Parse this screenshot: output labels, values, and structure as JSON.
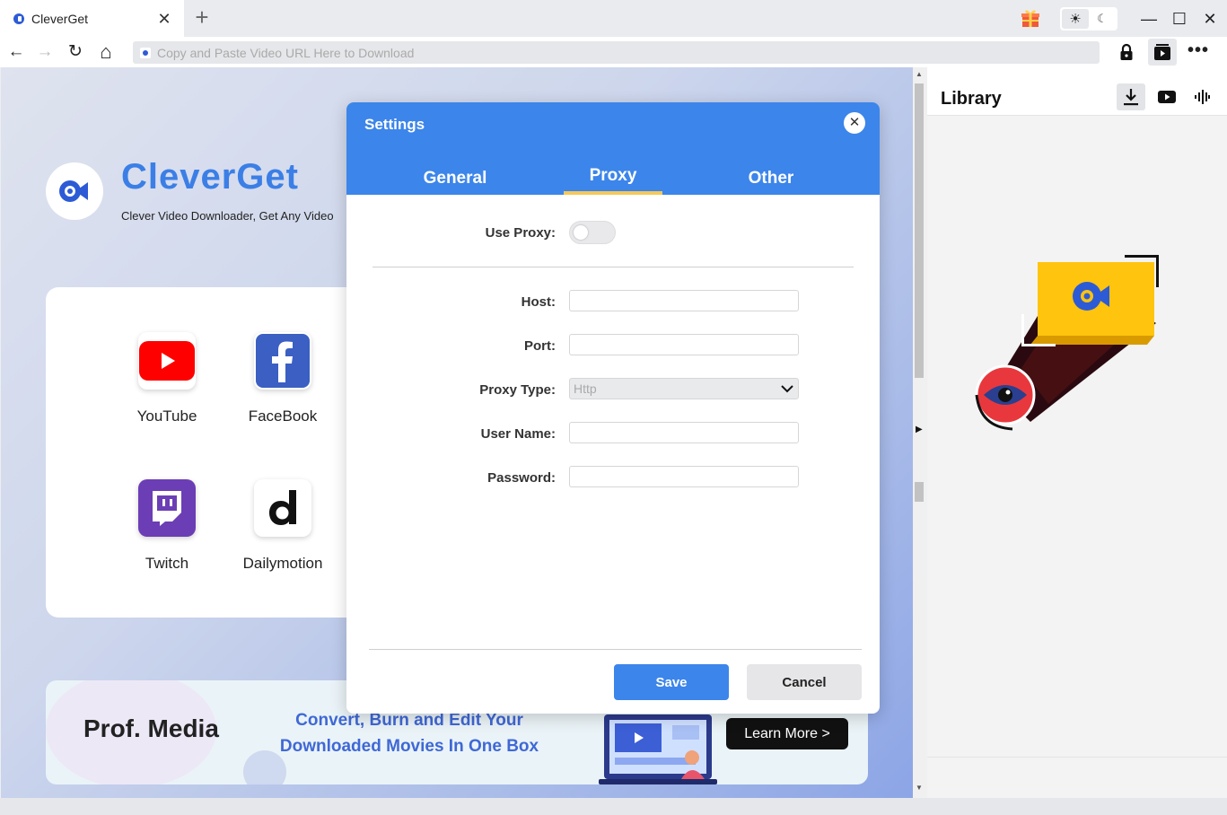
{
  "window": {
    "tab_title": "CleverGet",
    "tab_close": "✕",
    "new_tab": "+",
    "minimize": "—",
    "maximize": "☐",
    "close": "✕",
    "theme_light": "☀",
    "theme_dark": "☾"
  },
  "navbar": {
    "back": "←",
    "forward": "→",
    "reload": "↻",
    "home": "⌂",
    "url_placeholder": "Copy and Paste Video URL Here to Download",
    "more": "•••"
  },
  "home": {
    "brand": "CleverGet",
    "tagline": "Clever Video Downloader, Get Any Video",
    "sites": [
      {
        "label": "YouTube",
        "color": "#ff0000"
      },
      {
        "label": "FaceBook",
        "color": "#3b5fc2"
      },
      {
        "label": "Twitch",
        "color": "#6c3eb5"
      },
      {
        "label": "Dailymotion",
        "color": "#ffffff"
      }
    ],
    "banner": {
      "brand": "Prof. Media",
      "text_line1": "Convert, Burn and Edit Your",
      "text_line2": "Downloaded Movies In One Box",
      "button": "Learn More >"
    }
  },
  "library": {
    "title": "Library"
  },
  "settings": {
    "title": "Settings",
    "close": "✕",
    "tabs": [
      {
        "label": "General",
        "active": false
      },
      {
        "label": "Proxy",
        "active": true
      },
      {
        "label": "Other",
        "active": false
      }
    ],
    "use_proxy_label": "Use Proxy:",
    "use_proxy_on": false,
    "host_label": "Host:",
    "host_value": "",
    "port_label": "Port:",
    "port_value": "",
    "proxy_type_label": "Proxy Type:",
    "proxy_type_value": "Http",
    "user_name_label": "User Name:",
    "user_name_value": "",
    "password_label": "Password:",
    "password_value": "",
    "save": "Save",
    "cancel": "Cancel"
  },
  "colors": {
    "accent": "#3c85ea",
    "tab_underline": "#f5c85a",
    "brand": "#3b7fe6"
  }
}
